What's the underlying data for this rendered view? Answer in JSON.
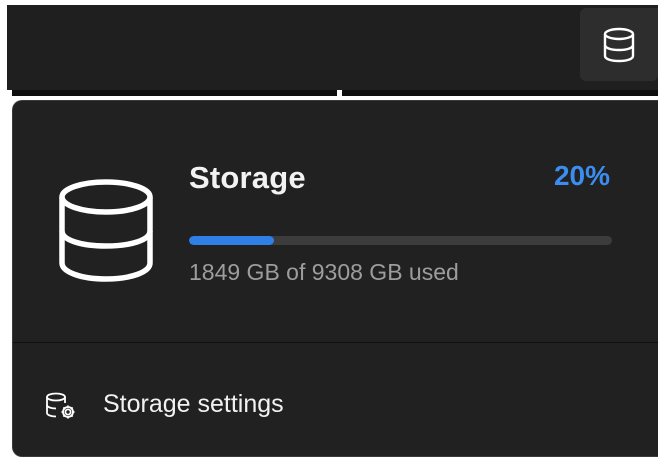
{
  "tray": {
    "icon": "database-icon"
  },
  "storage": {
    "title": "Storage",
    "percent_label": "20%",
    "used_fraction": 0.2,
    "usage_text": "1849 GB of 9308 GB used",
    "icon": "database-icon"
  },
  "settings": {
    "label": "Storage settings",
    "icon": "database-gear-icon"
  },
  "colors": {
    "accent": "#3b8ef0",
    "panel_background": "#212121",
    "taskbar_background": "#1f1f1f",
    "text_primary": "#f2f2f2",
    "text_secondary": "#9d9d9d"
  }
}
